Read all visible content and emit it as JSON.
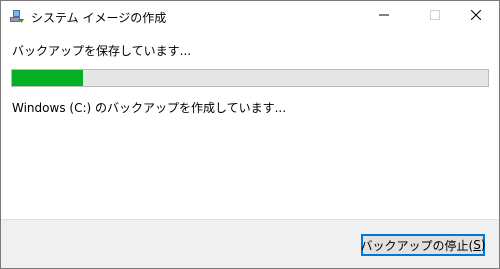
{
  "window": {
    "title": "システム イメージの作成",
    "icon": "system-image-icon"
  },
  "content": {
    "status_text": "バックアップを保存しています...",
    "progress_fraction": 0.15,
    "progress_color": "#06b025",
    "detail_text": "Windows (C:) のバックアップを作成しています..."
  },
  "footer": {
    "stop_button_label_prefix": "バックアップの停止(",
    "stop_button_accel": "S",
    "stop_button_label_suffix": ")"
  }
}
